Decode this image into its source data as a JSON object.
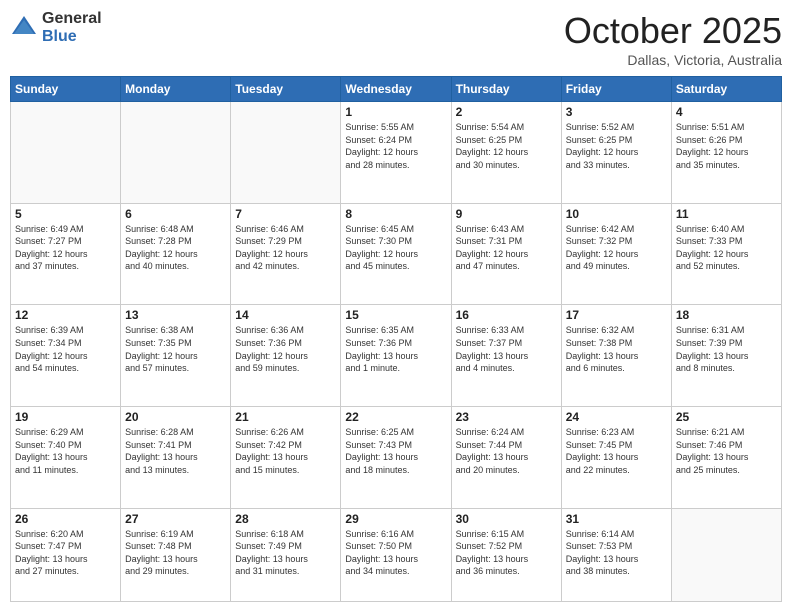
{
  "header": {
    "logo_general": "General",
    "logo_blue": "Blue",
    "month_title": "October 2025",
    "location": "Dallas, Victoria, Australia"
  },
  "weekdays": [
    "Sunday",
    "Monday",
    "Tuesday",
    "Wednesday",
    "Thursday",
    "Friday",
    "Saturday"
  ],
  "weeks": [
    [
      {
        "day": "",
        "info": ""
      },
      {
        "day": "",
        "info": ""
      },
      {
        "day": "",
        "info": ""
      },
      {
        "day": "1",
        "info": "Sunrise: 5:55 AM\nSunset: 6:24 PM\nDaylight: 12 hours\nand 28 minutes."
      },
      {
        "day": "2",
        "info": "Sunrise: 5:54 AM\nSunset: 6:25 PM\nDaylight: 12 hours\nand 30 minutes."
      },
      {
        "day": "3",
        "info": "Sunrise: 5:52 AM\nSunset: 6:25 PM\nDaylight: 12 hours\nand 33 minutes."
      },
      {
        "day": "4",
        "info": "Sunrise: 5:51 AM\nSunset: 6:26 PM\nDaylight: 12 hours\nand 35 minutes."
      }
    ],
    [
      {
        "day": "5",
        "info": "Sunrise: 6:49 AM\nSunset: 7:27 PM\nDaylight: 12 hours\nand 37 minutes."
      },
      {
        "day": "6",
        "info": "Sunrise: 6:48 AM\nSunset: 7:28 PM\nDaylight: 12 hours\nand 40 minutes."
      },
      {
        "day": "7",
        "info": "Sunrise: 6:46 AM\nSunset: 7:29 PM\nDaylight: 12 hours\nand 42 minutes."
      },
      {
        "day": "8",
        "info": "Sunrise: 6:45 AM\nSunset: 7:30 PM\nDaylight: 12 hours\nand 45 minutes."
      },
      {
        "day": "9",
        "info": "Sunrise: 6:43 AM\nSunset: 7:31 PM\nDaylight: 12 hours\nand 47 minutes."
      },
      {
        "day": "10",
        "info": "Sunrise: 6:42 AM\nSunset: 7:32 PM\nDaylight: 12 hours\nand 49 minutes."
      },
      {
        "day": "11",
        "info": "Sunrise: 6:40 AM\nSunset: 7:33 PM\nDaylight: 12 hours\nand 52 minutes."
      }
    ],
    [
      {
        "day": "12",
        "info": "Sunrise: 6:39 AM\nSunset: 7:34 PM\nDaylight: 12 hours\nand 54 minutes."
      },
      {
        "day": "13",
        "info": "Sunrise: 6:38 AM\nSunset: 7:35 PM\nDaylight: 12 hours\nand 57 minutes."
      },
      {
        "day": "14",
        "info": "Sunrise: 6:36 AM\nSunset: 7:36 PM\nDaylight: 12 hours\nand 59 minutes."
      },
      {
        "day": "15",
        "info": "Sunrise: 6:35 AM\nSunset: 7:36 PM\nDaylight: 13 hours\nand 1 minute."
      },
      {
        "day": "16",
        "info": "Sunrise: 6:33 AM\nSunset: 7:37 PM\nDaylight: 13 hours\nand 4 minutes."
      },
      {
        "day": "17",
        "info": "Sunrise: 6:32 AM\nSunset: 7:38 PM\nDaylight: 13 hours\nand 6 minutes."
      },
      {
        "day": "18",
        "info": "Sunrise: 6:31 AM\nSunset: 7:39 PM\nDaylight: 13 hours\nand 8 minutes."
      }
    ],
    [
      {
        "day": "19",
        "info": "Sunrise: 6:29 AM\nSunset: 7:40 PM\nDaylight: 13 hours\nand 11 minutes."
      },
      {
        "day": "20",
        "info": "Sunrise: 6:28 AM\nSunset: 7:41 PM\nDaylight: 13 hours\nand 13 minutes."
      },
      {
        "day": "21",
        "info": "Sunrise: 6:26 AM\nSunset: 7:42 PM\nDaylight: 13 hours\nand 15 minutes."
      },
      {
        "day": "22",
        "info": "Sunrise: 6:25 AM\nSunset: 7:43 PM\nDaylight: 13 hours\nand 18 minutes."
      },
      {
        "day": "23",
        "info": "Sunrise: 6:24 AM\nSunset: 7:44 PM\nDaylight: 13 hours\nand 20 minutes."
      },
      {
        "day": "24",
        "info": "Sunrise: 6:23 AM\nSunset: 7:45 PM\nDaylight: 13 hours\nand 22 minutes."
      },
      {
        "day": "25",
        "info": "Sunrise: 6:21 AM\nSunset: 7:46 PM\nDaylight: 13 hours\nand 25 minutes."
      }
    ],
    [
      {
        "day": "26",
        "info": "Sunrise: 6:20 AM\nSunset: 7:47 PM\nDaylight: 13 hours\nand 27 minutes."
      },
      {
        "day": "27",
        "info": "Sunrise: 6:19 AM\nSunset: 7:48 PM\nDaylight: 13 hours\nand 29 minutes."
      },
      {
        "day": "28",
        "info": "Sunrise: 6:18 AM\nSunset: 7:49 PM\nDaylight: 13 hours\nand 31 minutes."
      },
      {
        "day": "29",
        "info": "Sunrise: 6:16 AM\nSunset: 7:50 PM\nDaylight: 13 hours\nand 34 minutes."
      },
      {
        "day": "30",
        "info": "Sunrise: 6:15 AM\nSunset: 7:52 PM\nDaylight: 13 hours\nand 36 minutes."
      },
      {
        "day": "31",
        "info": "Sunrise: 6:14 AM\nSunset: 7:53 PM\nDaylight: 13 hours\nand 38 minutes."
      },
      {
        "day": "",
        "info": ""
      }
    ]
  ]
}
